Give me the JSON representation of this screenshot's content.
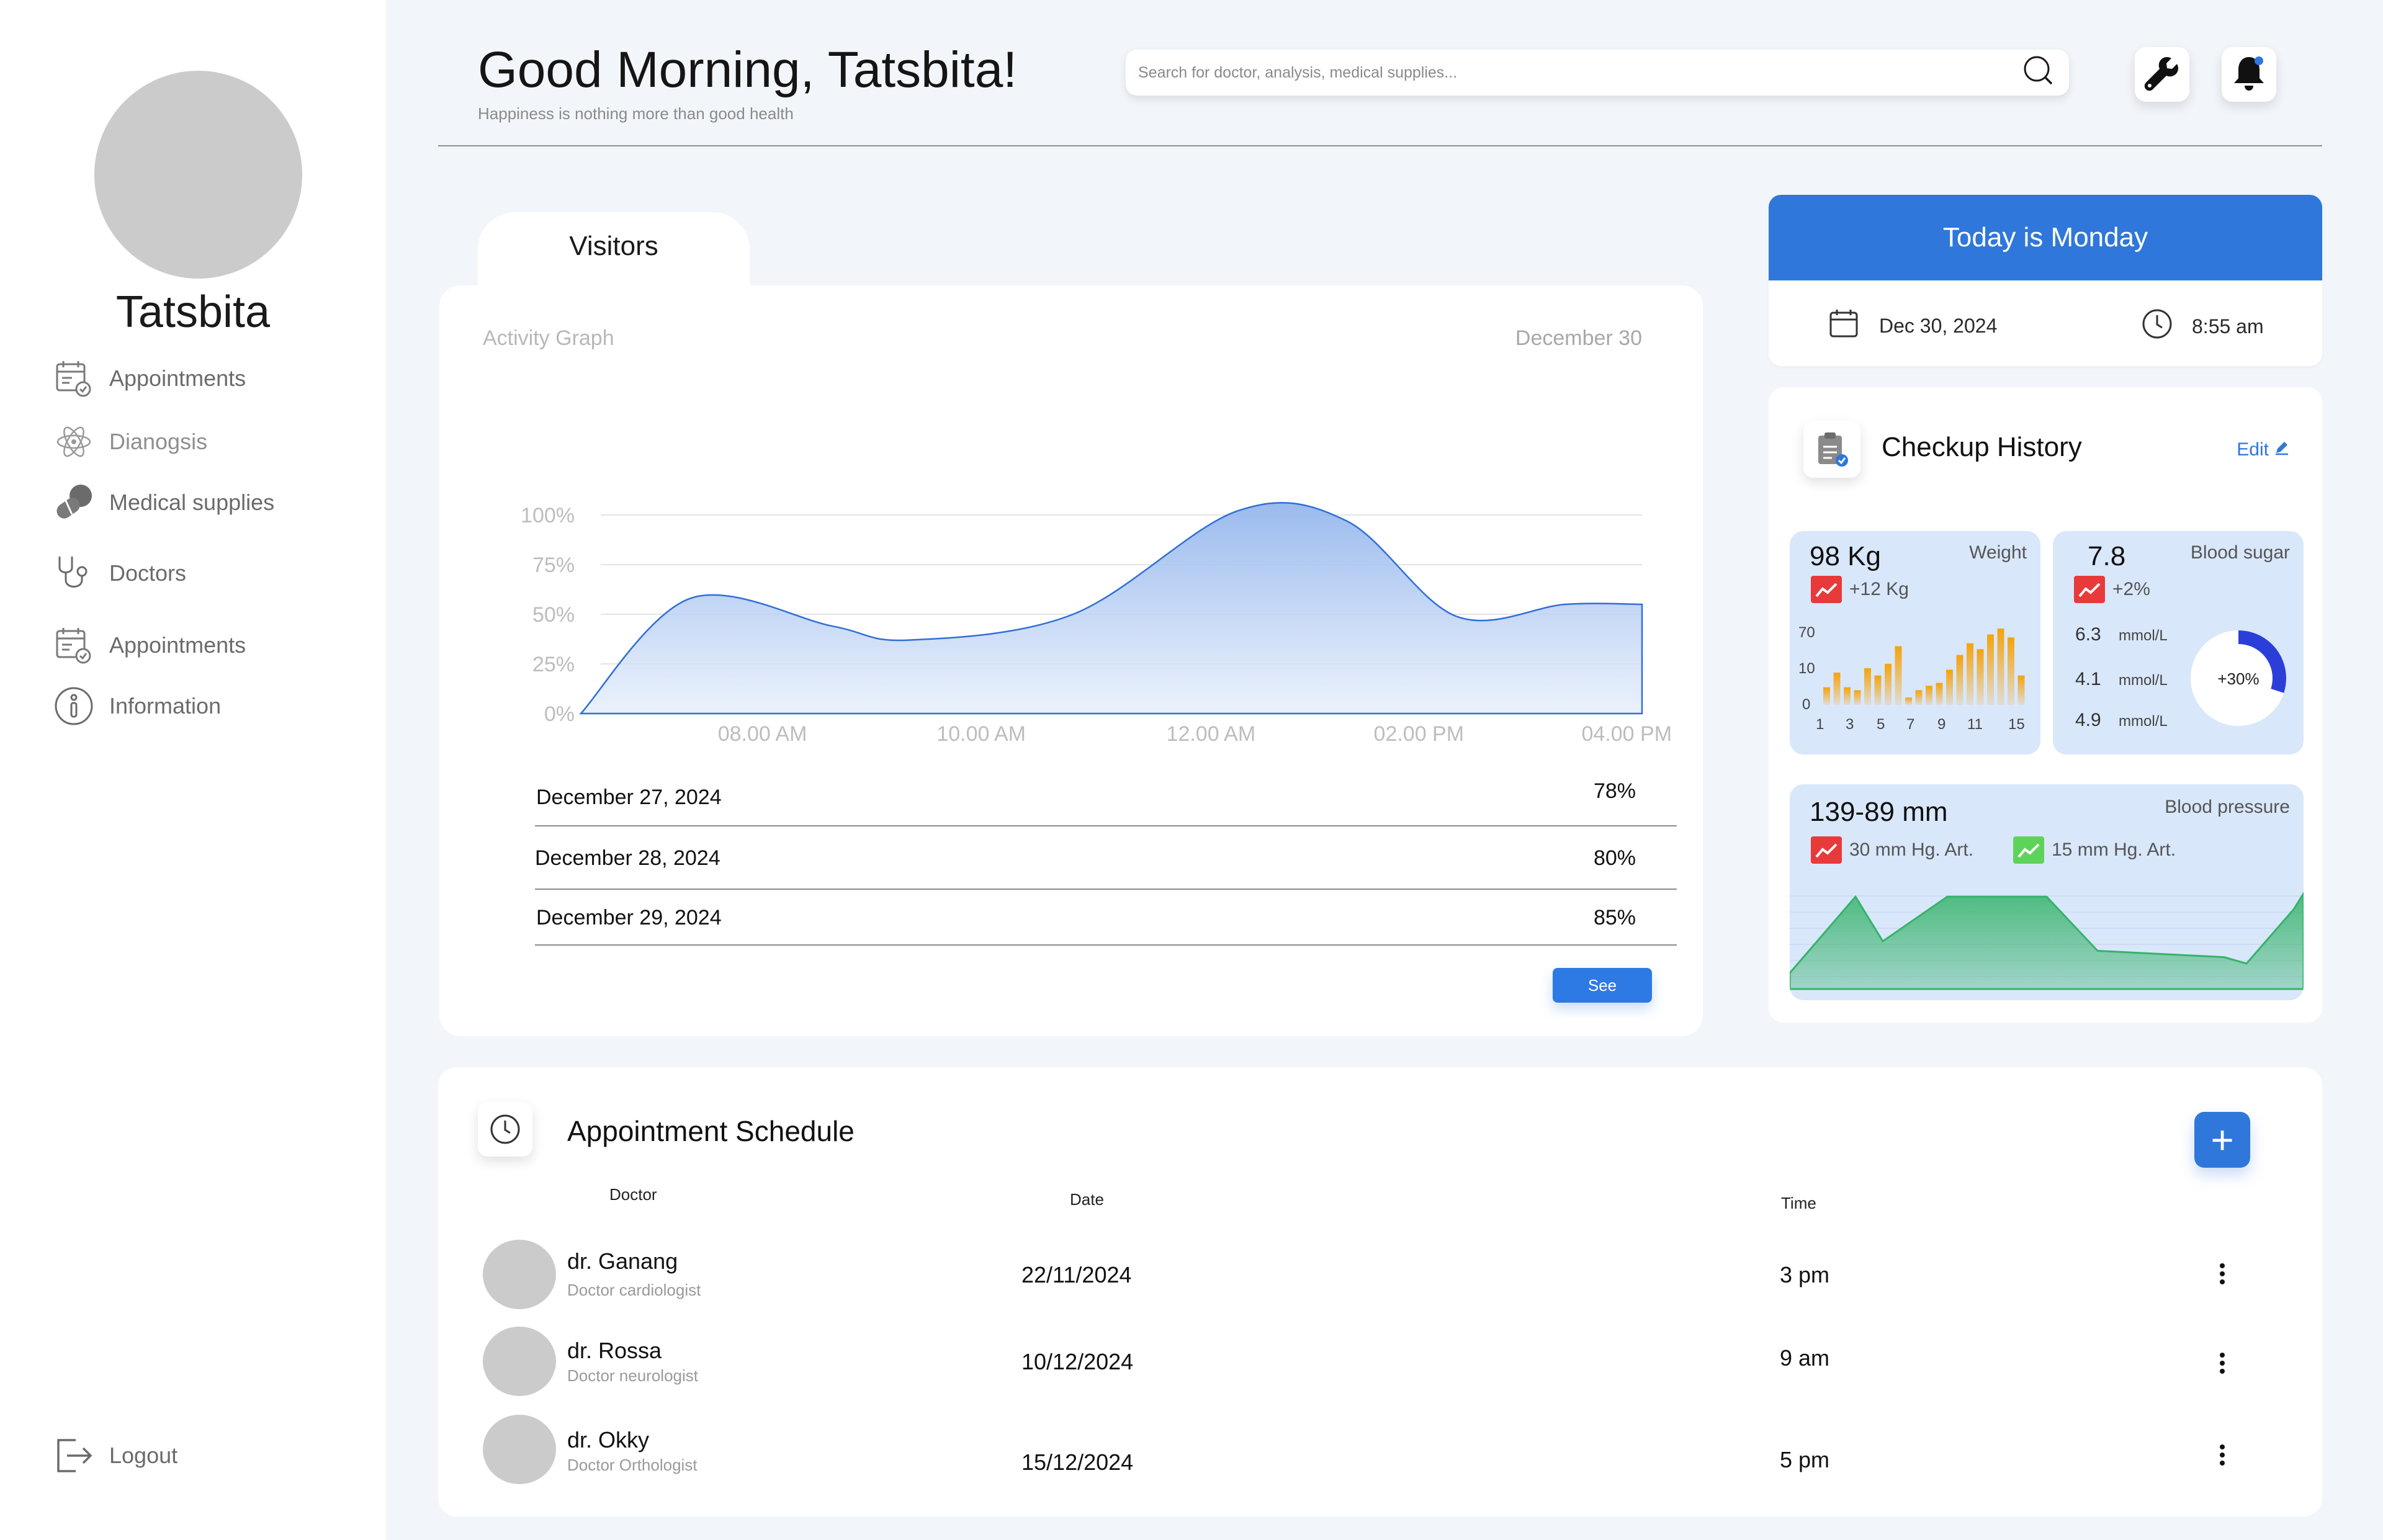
{
  "user": {
    "name": "Tatsbita"
  },
  "sidebar": {
    "items": [
      {
        "label": "Appointments"
      },
      {
        "label": "Dianogsis"
      },
      {
        "label": "Medical supplies"
      },
      {
        "label": "Doctors"
      },
      {
        "label": "Appointments"
      },
      {
        "label": "Information"
      }
    ],
    "logout_label": "Logout"
  },
  "header": {
    "greeting": "Good Morning, Tatsbita!",
    "subtitle": "Happiness is nothing more than good health",
    "search_placeholder": "Search for doctor, analysis, medical supplies..."
  },
  "visitors": {
    "tab_label": "Visitors",
    "title": "Activity Graph",
    "date": "December 30",
    "rows": [
      {
        "date": "December 27, 2024",
        "value": "78%"
      },
      {
        "date": "December 28, 2024",
        "value": "80%"
      },
      {
        "date": "December 29, 2024",
        "value": "85%"
      }
    ],
    "see_label": "See"
  },
  "chart_data": {
    "type": "area",
    "x": [
      "08.00 AM",
      "10.00 AM",
      "12.00 AM",
      "02.00 PM",
      "04.00 PM"
    ],
    "y_ticks": [
      "100%",
      "75%",
      "50%",
      "25%",
      "0%"
    ],
    "ylim": [
      0,
      100
    ],
    "x_points": [
      7,
      8,
      9.3,
      10,
      11.5,
      13,
      14,
      15,
      16,
      16.7
    ],
    "values": [
      0,
      58,
      44,
      37,
      50,
      102,
      97,
      49,
      55,
      55
    ],
    "color": "#2f6fd6"
  },
  "today": {
    "header": "Today is Monday",
    "date": "Dec 30, 2024",
    "time": "8:55 am"
  },
  "checkup": {
    "title": "Checkup History",
    "edit_label": "Edit",
    "weight": {
      "value": "98 Kg",
      "label": "Weight",
      "trend": "+12 Kg",
      "y_ticks": [
        "70",
        "10",
        "0"
      ],
      "x_ticks": [
        "1",
        "3",
        "5",
        "7",
        "9",
        "11",
        "15"
      ],
      "bars": [
        12,
        22,
        12,
        10,
        25,
        20,
        28,
        40,
        5,
        10,
        13,
        15,
        24,
        34,
        42,
        38,
        48,
        52,
        46,
        20
      ],
      "bar_color": "#f5a30b"
    },
    "sugar": {
      "value": "7.8",
      "label": "Blood sugar",
      "trend": "+2%",
      "readings": [
        {
          "value": "6.3",
          "unit": "mmol/L"
        },
        {
          "value": "4.1",
          "unit": "mmol/L"
        },
        {
          "value": "4.9",
          "unit": "mmol/L"
        }
      ],
      "ring_label": "+30%",
      "ring_fraction": 0.3,
      "ring_color": "#2b3fd8"
    },
    "pressure": {
      "value": "139-89 mm",
      "label": "Blood pressure",
      "trend_up": "30 mm Hg. Art.",
      "trend_down": "15 mm Hg. Art.",
      "line_values": [
        10,
        58,
        30,
        58,
        58,
        24,
        20,
        16,
        50,
        60
      ],
      "line_color": "#36b36a"
    },
    "trend_up_color": "#e83a3a",
    "trend_down_color": "#5ed35a"
  },
  "schedule": {
    "title": "Appointment Schedule",
    "add_label": "+",
    "columns": {
      "doctor": "Doctor",
      "date": "Date",
      "time": "Time"
    },
    "rows": [
      {
        "name": "dr. Ganang",
        "specialty": "Doctor cardiologist",
        "date": "22/11/2024",
        "time": "3 pm"
      },
      {
        "name": "dr. Rossa",
        "specialty": "Doctor neurologist",
        "date": "10/12/2024",
        "time": "9 am"
      },
      {
        "name": "dr. Okky",
        "specialty": "Doctor Orthologist",
        "date": "15/12/2024",
        "time": "5 pm"
      }
    ]
  }
}
